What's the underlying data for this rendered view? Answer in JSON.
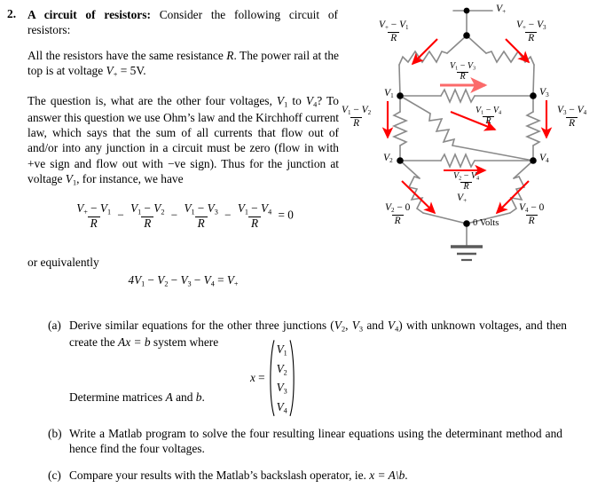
{
  "question": {
    "number": "2.",
    "heading_bold": "A circuit of resistors:",
    "heading_rest": " Consider the following circuit of resistors:",
    "paragraph_1_a": "All the resistors have the same resistance ",
    "paragraph_1_b": ". The power rail at the top is at voltage ",
    "paragraph_1_c": " = 5V.",
    "paragraph_2_a": "The question is, what are the other four voltages, ",
    "paragraph_2_b": " to ",
    "paragraph_2_c": "? To answer this question we use Ohm’s law and the Kirchhoff current law, which says that the sum of all currents that flow out of and/or into any junction in a circuit must be zero (flow in with +ve sign and flow out with −ve sign). Thus for the junction at voltage ",
    "paragraph_2_d": ", for instance, we have",
    "or_equivalently": "or equivalently",
    "equation_main": "(V+ − V1)/R − (V1 − V2)/R − (V1 − V3)/R − (V1 − V4)/R = 0",
    "equation_second": "4V1 − V2 − V3 − V4 = V+"
  },
  "parts": {
    "a": {
      "label": "(a)",
      "text_1": "Derive similar equations for the other three junctions (",
      "text_2": ", ",
      "text_3": " and ",
      "text_4": ") with unknown voltages, and then create the ",
      "text_5": " system where",
      "ax_eq_b": "Ax = b",
      "determine": "Determine matrices A and b."
    },
    "b": {
      "label": "(b)",
      "text": "Write a Matlab program to solve the four resulting linear equations using the determinant method and hence find the four voltages."
    },
    "c": {
      "label": "(c)",
      "text_1": "Compare your results with the Matlab’s backslash operator, ie. ",
      "text_2": "x = A\\b",
      "text_3": "."
    }
  },
  "vector": {
    "x_equals": "x =",
    "rows": [
      "V1",
      "V2",
      "V3",
      "V4"
    ]
  },
  "symbols": {
    "R": "R",
    "V_plus": "V+",
    "V1": "V1",
    "V2": "V2",
    "V3": "V3",
    "V4": "V4",
    "A": "A",
    "b": "b",
    "x": "x",
    "five_volts": "5V"
  },
  "circuit": {
    "title_node": "V+",
    "ground_label": "0 Volts",
    "node_labels": [
      "V1",
      "V2",
      "V3",
      "V4"
    ],
    "current_labels": [
      {
        "id": "top-left",
        "numerator": "V+ − V1",
        "denominator": "R"
      },
      {
        "id": "top-right",
        "numerator": "V+ − V3",
        "denominator": "R"
      },
      {
        "id": "mid-horiz",
        "numerator": "V1 − V3",
        "denominator": "R"
      },
      {
        "id": "left-vert",
        "numerator": "V1 − V2",
        "denominator": "R"
      },
      {
        "id": "right-vert",
        "numerator": "V3 − V4",
        "denominator": "R"
      },
      {
        "id": "diagonal",
        "numerator": "V1 − V4",
        "denominator": "R"
      },
      {
        "id": "bottom-horiz",
        "numerator": "V2 − V4",
        "denominator": "R"
      },
      {
        "id": "bottom-left",
        "numerator": "V2 − 0",
        "denominator": "R"
      },
      {
        "id": "bottom-right",
        "numerator": "V4 − 0",
        "denominator": "R"
      }
    ],
    "colors": {
      "wire": "#8a8a8a",
      "arrow": "#ff0000",
      "arrow_light": "#fb6a6a",
      "node": "#000000"
    }
  }
}
